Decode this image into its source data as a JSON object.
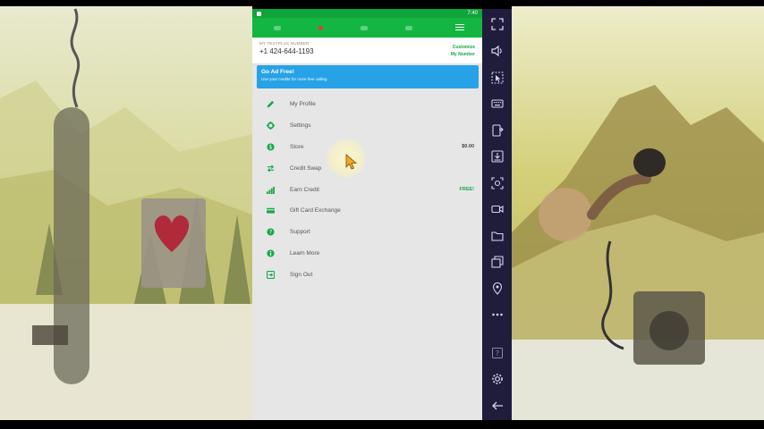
{
  "phone": {
    "status_time": "7:40",
    "number_label": "MY TEXTPLUS NUMBER",
    "number": "+1 424-644-1193",
    "customize_line1": "Customize",
    "customize_line2": "My Number",
    "ad_title": "Go Ad Free!",
    "ad_subtitle": "Use your credits for more free calling",
    "menu": [
      {
        "label": "My Profile",
        "icon": "pencil-icon",
        "value": ""
      },
      {
        "label": "Settings",
        "icon": "gear-icon",
        "value": ""
      },
      {
        "label": "Store",
        "icon": "dollar-icon",
        "value": "$0.00"
      },
      {
        "label": "Credit Swap",
        "icon": "swap-icon",
        "value": ""
      },
      {
        "label": "Earn Credit",
        "icon": "signal-icon",
        "value": "FREE!"
      },
      {
        "label": "Gift Card Exchange",
        "icon": "card-icon",
        "value": ""
      },
      {
        "label": "Support",
        "icon": "help-icon",
        "value": ""
      },
      {
        "label": "Learn More",
        "icon": "info-icon",
        "value": ""
      },
      {
        "label": "Sign Out",
        "icon": "signout-icon",
        "value": ""
      }
    ]
  },
  "sidebar": {
    "buttons": [
      "fullscreen-icon",
      "volume-icon",
      "pointer-icon",
      "keyboard-icon",
      "apk-install-icon",
      "import-icon",
      "screenshot-icon",
      "record-icon",
      "folder-icon",
      "multi-window-icon",
      "location-icon",
      "more-icon",
      "help-icon",
      "settings-icon",
      "back-icon"
    ]
  },
  "colors": {
    "primary_green": "#13b640",
    "accent_blue": "#27a2e6",
    "sidebar_bg": "#1f1d3b"
  }
}
